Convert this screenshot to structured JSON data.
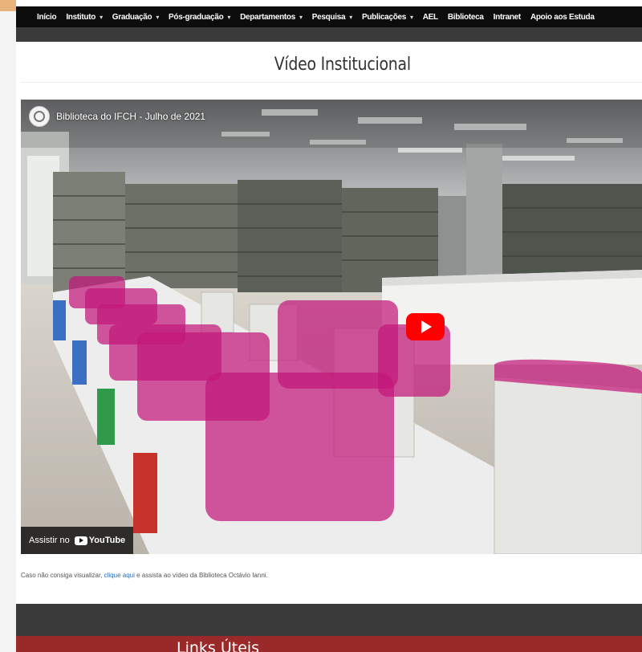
{
  "nav": {
    "items": [
      {
        "label": "Início",
        "dropdown": false
      },
      {
        "label": "Instituto",
        "dropdown": true
      },
      {
        "label": "Graduação",
        "dropdown": true
      },
      {
        "label": "Pós-graduação",
        "dropdown": true
      },
      {
        "label": "Departamentos",
        "dropdown": true
      },
      {
        "label": "Pesquisa",
        "dropdown": true
      },
      {
        "label": "Publicações",
        "dropdown": true
      },
      {
        "label": "AEL",
        "dropdown": false
      },
      {
        "label": "Biblioteca",
        "dropdown": false
      },
      {
        "label": "Intranet",
        "dropdown": false
      },
      {
        "label": "Apoio aos Estuda",
        "dropdown": false
      }
    ]
  },
  "section": {
    "title": "Vídeo Institucional"
  },
  "video": {
    "title": "Biblioteca do IFCH - Julho de 2021",
    "watch_on_label": "Assistir no",
    "youtube_label": "YouTube"
  },
  "caption": {
    "before": "Caso não consiga visualizar,",
    "link": "clique aqui",
    "after": "e assista ao vídeo da Biblioteca Octávio Ianni."
  },
  "footer": {
    "heading": "Links Úteis"
  },
  "colors": {
    "nav_bg": "#0c0c0c",
    "subbar_bg": "#3a3a3a",
    "footer_red": "#9a2a2a",
    "link": "#2d6cb5",
    "play_red": "#ff0000",
    "divider_pink": "#c2187a"
  }
}
